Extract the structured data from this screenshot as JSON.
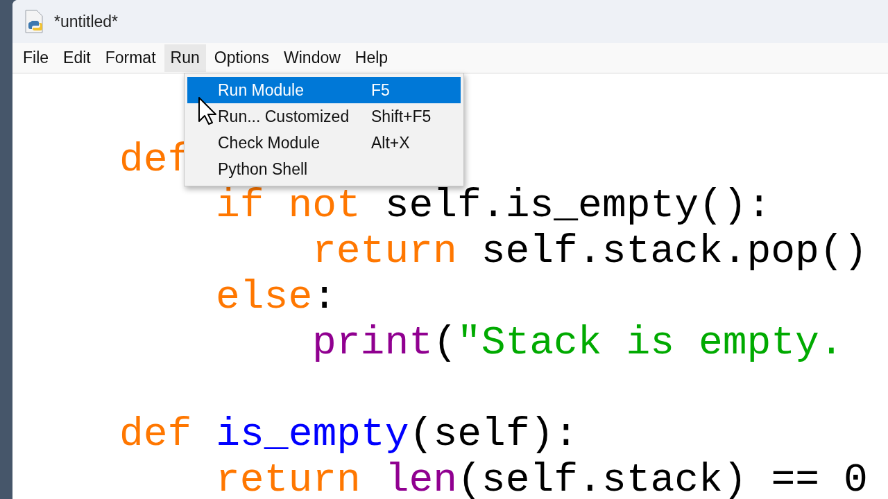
{
  "window": {
    "title": "*untitled*"
  },
  "menubar": [
    {
      "label": "File",
      "selected": false
    },
    {
      "label": "Edit",
      "selected": false
    },
    {
      "label": "Format",
      "selected": false
    },
    {
      "label": "Run",
      "selected": true
    },
    {
      "label": "Options",
      "selected": false
    },
    {
      "label": "Window",
      "selected": false
    },
    {
      "label": "Help",
      "selected": false
    }
  ],
  "run_menu": [
    {
      "label": "Run Module",
      "shortcut": "F5",
      "selected": true
    },
    {
      "label": "Run... Customized",
      "shortcut": "Shift+F5",
      "selected": false
    },
    {
      "label": "Check Module",
      "shortcut": "Alt+X",
      "selected": false
    },
    {
      "label": "Python Shell",
      "selected": false
    }
  ],
  "code": {
    "lines": [
      {
        "kind": "code",
        "tokens": [
          {
            "kind": "keyword",
            "text": "def"
          }
        ],
        "children": [
          {
            "kind": "code",
            "tokens": [
              {
                "kind": "keyword",
                "text": "if not"
              },
              {
                "kind": "plain",
                "text": " self.is_empty():"
              }
            ],
            "children": [
              {
                "kind": "code",
                "tokens": [
                  {
                    "kind": "keyword",
                    "text": "return"
                  },
                  {
                    "kind": "plain",
                    "text": " self.stack.pop()"
                  }
                ]
              }
            ]
          },
          {
            "kind": "code",
            "tokens": [
              {
                "kind": "keyword",
                "text": "else"
              },
              {
                "kind": "plain",
                "text": ":"
              }
            ],
            "children": [
              {
                "kind": "code",
                "tokens": [
                  {
                    "kind": "builtin",
                    "text": "print"
                  },
                  {
                    "kind": "plain",
                    "text": "("
                  },
                  {
                    "kind": "string",
                    "text": "\"Stack is empty. "
                  }
                ]
              }
            ]
          }
        ]
      },
      {
        "kind": "blank"
      },
      {
        "kind": "code",
        "tokens": [
          {
            "kind": "keyword",
            "text": "def "
          },
          {
            "kind": "definition",
            "text": "is_empty"
          },
          {
            "kind": "plain",
            "text": "(self):"
          }
        ],
        "children": [
          {
            "kind": "code",
            "tokens": [
              {
                "kind": "keyword",
                "text": "return "
              },
              {
                "kind": "builtin",
                "text": "len"
              },
              {
                "kind": "plain",
                "text": "(self.stack) == 0"
              }
            ]
          }
        ]
      }
    ]
  }
}
